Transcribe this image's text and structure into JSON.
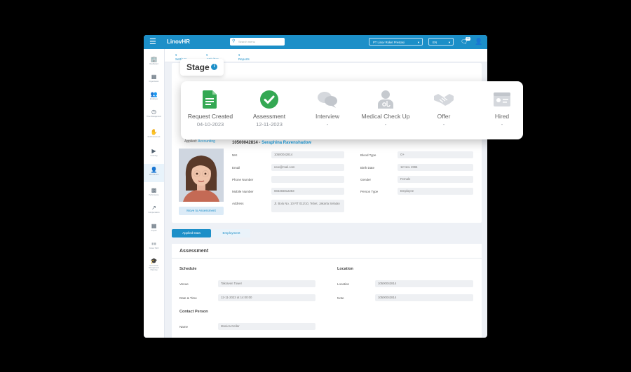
{
  "topbar": {
    "brand": "LinovHR",
    "search_placeholder": "Search menu",
    "company": "PT Linov Roket Prestasi",
    "language": "EN",
    "notif_count": "99"
  },
  "subnav": {
    "settings": "Settings",
    "activities": "Activities",
    "reports": "Reports"
  },
  "sidebar": [
    {
      "label": "Dashboard",
      "icon": "building-icon"
    },
    {
      "label": "Organization",
      "icon": "org-chart-icon"
    },
    {
      "label": "Employee",
      "icon": "people-icon"
    },
    {
      "label": "Time Management",
      "icon": "clock-icon"
    },
    {
      "label": "Reimbursement",
      "icon": "hand-money-icon"
    },
    {
      "label": "Learning",
      "icon": "video-icon"
    },
    {
      "label": "Recruitment",
      "icon": "person-add-icon"
    },
    {
      "label": "Performance",
      "icon": "bar-chart-icon"
    },
    {
      "label": "Compensation",
      "icon": "trend-chart-icon"
    },
    {
      "label": "Payroll",
      "icon": "calendar-icon"
    },
    {
      "label": "Career Path",
      "icon": "signpost-icon"
    },
    {
      "label": "Succession Management Planning",
      "icon": "graduation-icon"
    }
  ],
  "stage": {
    "title": "Stage",
    "steps": [
      {
        "label": "Request Created",
        "date": "04-10-2023",
        "status": "done"
      },
      {
        "label": "Assessment",
        "date": "12-11-2023",
        "status": "current"
      },
      {
        "label": "Interview",
        "date": "-",
        "status": "future"
      },
      {
        "label": "Medical Check Up",
        "date": "-",
        "status": "future"
      },
      {
        "label": "Offer",
        "date": "-",
        "status": "future"
      },
      {
        "label": "Hired",
        "date": "-",
        "status": "future"
      }
    ]
  },
  "profile": {
    "applied_label": "Applied",
    "applied_value": "Accounting",
    "emp_id": "10500042814",
    "emp_sep": " - ",
    "emp_name": "Seraphina Ravenshadow",
    "move_button": "Move to Assessment",
    "left_fields": [
      {
        "label": "NIK",
        "value": "10500042814"
      },
      {
        "label": "Email",
        "value": "new@mail.com"
      },
      {
        "label": "Phone Number",
        "value": ""
      },
      {
        "label": "Mobile Number",
        "value": "083456812283"
      },
      {
        "label": "Address",
        "value": "Jl. Bolu No. 10 RT 011/10, Tebet, Jakarta Selatan"
      }
    ],
    "right_fields": [
      {
        "label": "Blood Type",
        "value": "O+"
      },
      {
        "label": "Birth Date",
        "value": "12 Nov 1996"
      },
      {
        "label": "Gender",
        "value": "Female"
      },
      {
        "label": "Person Type",
        "value": "Employee"
      }
    ]
  },
  "tabs": {
    "applied_data": "Applied Data",
    "employment": "Employment"
  },
  "assessment": {
    "title": "Assessment",
    "schedule_title": "Schedule",
    "location_title": "Location",
    "contact_title": "Contact Person",
    "venue_label": "Venue",
    "venue_value": "Takraven Tower",
    "datetime_label": "Date & Time",
    "datetime_value": "12-11-2023 at 14:00:00",
    "location_label": "Location",
    "location_value": "10500042814",
    "note_label": "Note",
    "note_value": "10500042814",
    "name_label": "Name",
    "name_value": "Monica Gellar"
  }
}
